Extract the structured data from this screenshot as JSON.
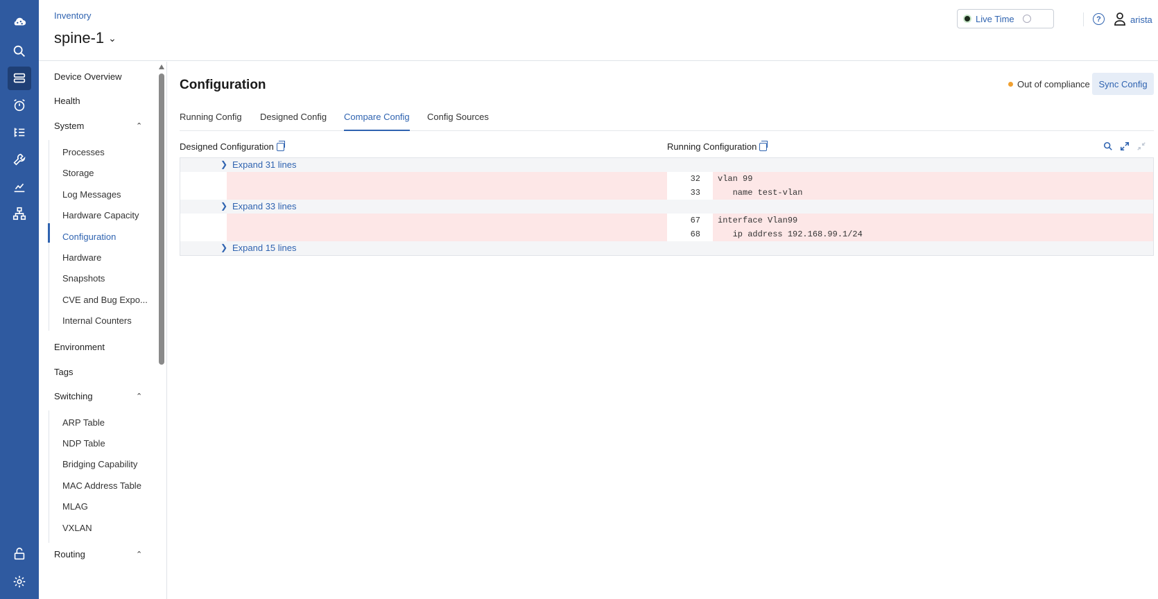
{
  "header": {
    "breadcrumb": "Inventory",
    "device_title": "spine-1",
    "live_time_label": "Live Time",
    "help_label": "?",
    "username": "arista"
  },
  "rail": {
    "icons": [
      "cloud-logo-icon",
      "search-icon",
      "devices-icon",
      "alarm-icon",
      "tasks-icon",
      "wrench-icon",
      "dashboard-icon",
      "topology-icon",
      "unlock-icon",
      "gear-icon"
    ]
  },
  "nav": {
    "items": {
      "device_overview": "Device Overview",
      "health": "Health",
      "system": "System",
      "environment": "Environment",
      "tags": "Tags",
      "switching": "Switching",
      "routing": "Routing"
    },
    "system_sub": [
      "Processes",
      "Storage",
      "Log Messages",
      "Hardware Capacity",
      "Configuration",
      "Hardware",
      "Snapshots",
      "CVE and Bug Expo...",
      "Internal Counters"
    ],
    "switching_sub": [
      "ARP Table",
      "NDP Table",
      "Bridging Capability",
      "MAC Address Table",
      "MLAG",
      "VXLAN"
    ],
    "active": "Configuration"
  },
  "main": {
    "title": "Configuration",
    "compliance_status": "Out of compliance",
    "compliance_color": "#f0a030",
    "sync_button": "Sync Config",
    "tabs": [
      "Running Config",
      "Designed Config",
      "Compare Config",
      "Config Sources"
    ],
    "active_tab": "Compare Config",
    "designed_label": "Designed Configuration",
    "running_label": "Running Configuration"
  },
  "diff": {
    "expand_1": "Expand 31 lines",
    "expand_2": "Expand 33 lines",
    "expand_3": "Expand 15 lines",
    "lines": [
      {
        "num": "32",
        "code": "vlan 99"
      },
      {
        "num": "33",
        "code": "   name test-vlan"
      },
      {
        "num": "67",
        "code": "interface Vlan99"
      },
      {
        "num": "68",
        "code": "   ip address 192.168.99.1/24"
      }
    ]
  },
  "colors": {
    "rail": "#2f5aa0",
    "accent": "#2f63b0",
    "diff_removed": "#fde7e7"
  }
}
